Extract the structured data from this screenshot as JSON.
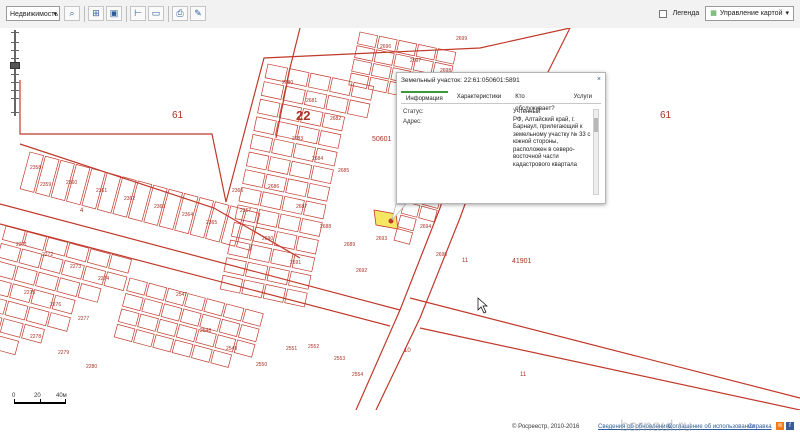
{
  "toolbar": {
    "select_value": "Недвижимость",
    "legend_label": "Легенда",
    "layers_label": "Управление картой"
  },
  "map": {
    "labels": {
      "left_61": "61",
      "right_61": "61",
      "district_22": "22",
      "quarter_50601": "50601",
      "quarter_41901": "41901",
      "num_10": "10",
      "num_11": "11",
      "num_11b": "11",
      "num_4": "4"
    },
    "parcels_left": [
      "2358",
      "2359",
      "2360",
      "2361",
      "2362",
      "2363",
      "2364",
      "2365",
      "2366",
      "2367",
      "2368",
      "2369",
      "2370",
      "2371",
      "2372",
      "2373",
      "2374",
      "2375",
      "2376",
      "2377",
      "2378",
      "2379"
    ],
    "parcels_center": [
      "2680",
      "2681",
      "2682",
      "2683",
      "2684",
      "2685",
      "2686",
      "2687",
      "2688",
      "2689",
      "2690",
      "2691",
      "2692",
      "2693",
      "2694",
      "2695",
      "2696",
      "2697",
      "2698",
      "2699",
      "2700",
      "2701",
      "2702",
      "2703",
      "2704",
      "2705",
      "2706",
      "2707",
      "2708",
      "2709"
    ],
    "parcels_bottom": [
      "2547",
      "2548",
      "2549",
      "2550",
      "2551",
      "2552",
      "2553",
      "2554",
      "2555",
      "2556",
      "2557",
      "2558",
      "2559",
      "2560",
      "2561",
      "2562",
      "2563",
      "2564",
      "2565",
      "2566",
      "2567",
      "2568",
      "2569",
      "2570"
    ],
    "parcels_lower_left": [
      "2271",
      "2272",
      "2273",
      "2274",
      "2275",
      "2276",
      "2277",
      "2278",
      "2279",
      "2280",
      "2281",
      "2282",
      "2283",
      "2284",
      "2285",
      "2286",
      "2287",
      "2288",
      "2289",
      "2290",
      "2291",
      "2292",
      "2293",
      "2294",
      "2295",
      "2296",
      "2297",
      "2298"
    ]
  },
  "popup": {
    "title": "Земельный участок: 22:61:050601:5891",
    "close": "×",
    "tabs": [
      "Информация",
      "Характеристики",
      "Кто обслуживает?",
      "Услуги"
    ],
    "status_label": "Статус:",
    "status_value": "Учтенный",
    "address_label": "Адрес:",
    "address_value": "РФ, Алтайский край, г. Барнаул, прилегающий к земельному участку № 33 с южной стороны, расположен в северо-восточной части кадастрового квартала"
  },
  "scale": {
    "labels": [
      "0",
      "20",
      "40м"
    ]
  },
  "footer": {
    "copyright": "© Росреестр, 2010-2016",
    "link1": "Сведения об обновлениях",
    "link2": "Соглашение об использовании",
    "link3": "Справка"
  },
  "watermark": "barnaul.ru"
}
